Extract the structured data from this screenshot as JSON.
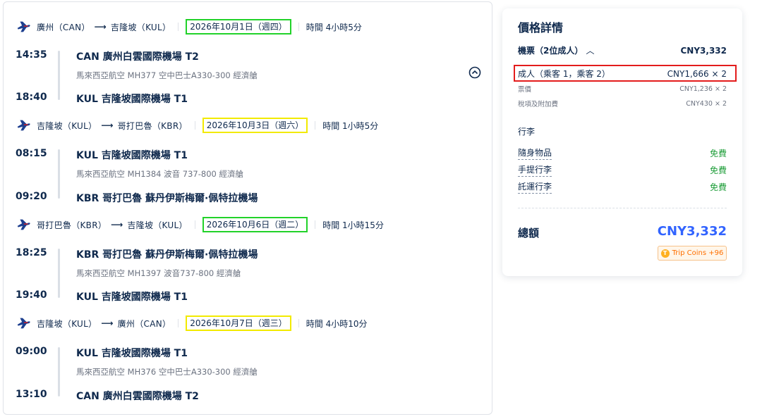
{
  "segments": [
    {
      "from": "廣州（CAN）",
      "to": "吉隆坡（KUL）",
      "date": "2026年10月1日（週四）",
      "duration": "時間 4小時5分",
      "dep_time": "14:35",
      "dep_airport": "CAN 廣州白雲國際機場 T2",
      "flight_info": "馬來西亞航空 MH377 空中巴士A330-300 經濟艙",
      "arr_time": "18:40",
      "arr_airport": "KUL 吉隆坡國際機場 T1"
    },
    {
      "from": "吉隆坡（KUL）",
      "to": "哥打巴魯（KBR）",
      "date": "2026年10月3日（週六）",
      "duration": "時間 1小時5分",
      "dep_time": "08:15",
      "dep_airport": "KUL 吉隆坡國際機場 T1",
      "flight_info": "馬來西亞航空 MH1384 波音 737-800 經濟艙",
      "arr_time": "09:20",
      "arr_airport": "KBR 哥打巴魯 蘇丹伊斯梅爾·佩特拉機場"
    },
    {
      "from": "哥打巴魯（KBR）",
      "to": "吉隆坡（KUL）",
      "date": "2026年10月6日（週二）",
      "duration": "時間 1小時15分",
      "dep_time": "18:25",
      "dep_airport": "KBR 哥打巴魯 蘇丹伊斯梅爾·佩特拉機場",
      "flight_info": "馬來西亞航空 MH1397 波音737-800 經濟艙",
      "arr_time": "19:40",
      "arr_airport": "KUL 吉隆坡國際機場 T1"
    },
    {
      "from": "吉隆坡（KUL）",
      "to": "廣州（CAN）",
      "date": "2026年10月7日（週三）",
      "duration": "時間 4小時10分",
      "dep_time": "09:00",
      "dep_airport": "KUL 吉隆坡國際機場 T1",
      "flight_info": "馬來西亞航空 MH376 空中巴士A330-300 經濟艙",
      "arr_time": "13:10",
      "arr_airport": "CAN 廣州白雲國際機場 T2"
    }
  ],
  "price": {
    "title": "價格詳情",
    "ticket_label": "機票（2位成人）",
    "ticket_value": "CNY3,332",
    "adult_label": "成人（乘客 1，乘客 2）",
    "adult_value": "CNY1,666 × 2",
    "fare_label": "票價",
    "fare_value": "CNY1,236 × 2",
    "tax_label": "稅項及附加費",
    "tax_value": "CNY430 × 2",
    "baggage_title": "行李",
    "baggage": [
      {
        "label": "隨身物品",
        "value": "免費"
      },
      {
        "label": "手提行李",
        "value": "免費"
      },
      {
        "label": "託運行李",
        "value": "免費"
      }
    ],
    "total_label": "總額",
    "total_value": "CNY3,332",
    "coins": "Trip Coins +96"
  },
  "colors": {
    "brand_navy": "#0f294d",
    "accent_blue": "#3264ff",
    "free_green": "#1f9e3a",
    "highlight_red": "#e31c1c",
    "highlight_green": "#22d22a",
    "highlight_yellow": "#f2ea00"
  },
  "icons": {
    "airline_logo": "malaysia-airlines-logo",
    "collapse": "chevron-up-circle-icon",
    "coin": "coin-icon"
  }
}
